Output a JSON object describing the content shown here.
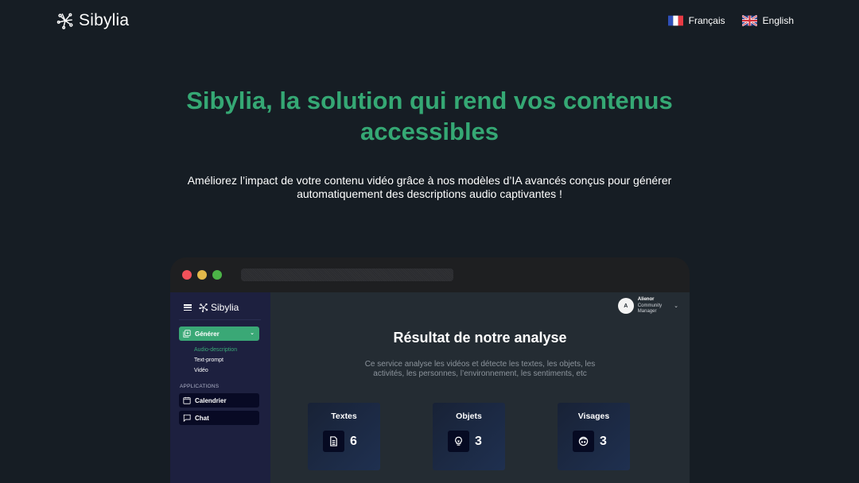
{
  "header": {
    "brand": "Sibylia",
    "languages": [
      {
        "label": "Français",
        "flag": "fr-flag-icon"
      },
      {
        "label": "English",
        "flag": "uk-flag-icon"
      }
    ]
  },
  "hero": {
    "title_line1": "Sibylia, la solution qui rend vos contenus",
    "title_line2": "accessibles",
    "subtitle_line1": "Améliorez l’impact de votre contenu vidéo grâce à nos modèles d’IA avancés conçus pour générer",
    "subtitle_line2": "automatiquement des descriptions audio captivantes !"
  },
  "colors": {
    "accent": "#35a874",
    "background": "#161d24",
    "sidebar": "#1d203f",
    "main": "#242c33"
  },
  "mockup": {
    "sidebar": {
      "brand": "Sibylia",
      "generate_label": "Générer",
      "sub_items": [
        {
          "label": "Audio-description",
          "active": true
        },
        {
          "label": "Text-prompt",
          "active": false
        },
        {
          "label": "Vidéo",
          "active": false
        }
      ],
      "apps_section_label": "APPLICATIONS",
      "apps": [
        {
          "label": "Calendrier",
          "icon": "calendar-icon"
        },
        {
          "label": "Chat",
          "icon": "chat-icon"
        }
      ]
    },
    "user": {
      "initial": "A",
      "name": "Alienor",
      "role_line1": "Community",
      "role_line2": "Manager"
    },
    "main": {
      "title": "Résultat de notre analyse",
      "desc_line1": "Ce service analyse les vidéos et détecte les textes, les objets, les",
      "desc_line2": "activités, les personnes, l’environnement, les sentiments, etc",
      "cards": [
        {
          "title": "Textes",
          "value": "6",
          "icon": "document-icon"
        },
        {
          "title": "Objets",
          "value": "3",
          "icon": "lightbulb-icon"
        },
        {
          "title": "Visages",
          "value": "3",
          "icon": "face-icon"
        }
      ]
    }
  }
}
